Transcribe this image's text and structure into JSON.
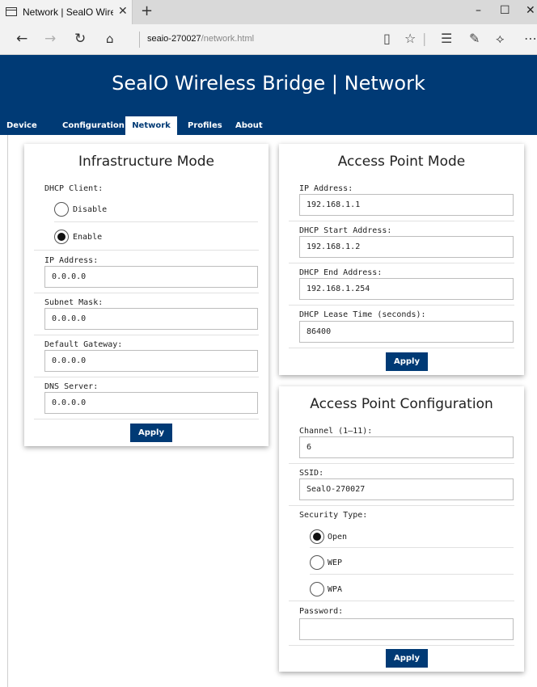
{
  "browser": {
    "tab_title": "Network | SealO Wireless Bridge | Network",
    "tab_close": "✕",
    "new_tab": "+",
    "url_host": "seaio-270027",
    "url_path": "/network.html",
    "window_controls": {
      "minimize": "–",
      "maximize": "☐",
      "close": "✕"
    },
    "toolbar_icons": [
      "reading-view-icon",
      "favorite-star-icon",
      "hub-icon",
      "web-note-icon",
      "share-icon",
      "more-icon"
    ]
  },
  "header": {
    "title": "SealO Wireless Bridge | Network",
    "bg_color": "#003a75"
  },
  "nav": {
    "items": [
      "Device",
      "Configuration",
      "Network",
      "Profiles",
      "About"
    ],
    "active": "Network"
  },
  "infrastructure": {
    "title": "Infrastructure Mode",
    "dhcp_label": "DHCP Client:",
    "dhcp_options": [
      "Disable",
      "Enable"
    ],
    "dhcp_selected": "Enable",
    "ip_label": "IP Address:",
    "ip_value": "0.0.0.0",
    "subnet_label": "Subnet Mask:",
    "subnet_value": "0.0.0.0",
    "gateway_label": "Default Gateway:",
    "gateway_value": "0.0.0.0",
    "dns_label": "DNS Server:",
    "dns_value": "0.0.0.0",
    "apply_label": "Apply"
  },
  "access_point": {
    "title": "Access Point Mode",
    "ip_label": "IP Address:",
    "ip_value": "192.168.1.1",
    "dhcp_start_label": "DHCP Start Address:",
    "dhcp_start_value": "192.168.1.2",
    "dhcp_end_label": "DHCP End Address:",
    "dhcp_end_value": "192.168.1.254",
    "lease_label": "DHCP Lease Time (seconds):",
    "lease_value": "86400",
    "apply_label": "Apply"
  },
  "ap_config": {
    "title": "Access Point Configuration",
    "channel_label": "Channel (1–11):",
    "channel_value": "6",
    "ssid_label": "SSID:",
    "ssid_value": "SealO-270027",
    "security_label": "Security Type:",
    "security_options": [
      "Open",
      "WEP",
      "WPA"
    ],
    "security_selected": "Open",
    "password_label": "Password:",
    "password_value": "",
    "apply_label": "Apply"
  }
}
